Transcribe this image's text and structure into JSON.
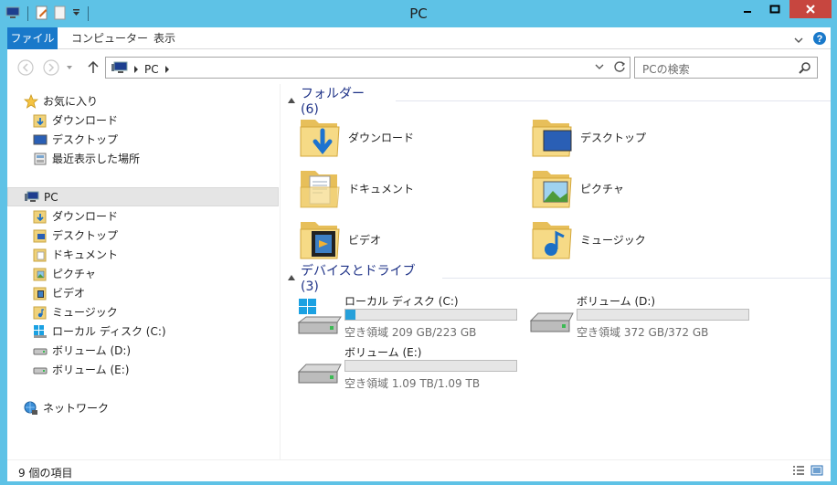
{
  "window": {
    "title": "PC"
  },
  "ribbon": {
    "tabs": [
      {
        "label": "ファイル"
      },
      {
        "label": "コンピューター"
      },
      {
        "label": "表示"
      }
    ]
  },
  "address": {
    "crumb": "PC"
  },
  "search": {
    "placeholder": "PCの検索"
  },
  "nav": {
    "favorites": {
      "label": "お気に入り",
      "items": [
        "ダウンロード",
        "デスクトップ",
        "最近表示した場所"
      ]
    },
    "pc": {
      "label": "PC",
      "items": [
        "ダウンロード",
        "デスクトップ",
        "ドキュメント",
        "ピクチャ",
        "ビデオ",
        "ミュージック",
        "ローカル ディスク (C:)",
        "ボリューム (D:)",
        "ボリューム (E:)"
      ]
    },
    "network": {
      "label": "ネットワーク"
    }
  },
  "content": {
    "folders_group": "フォルダー (6)",
    "folders": [
      "ダウンロード",
      "デスクトップ",
      "ドキュメント",
      "ピクチャ",
      "ビデオ",
      "ミュージック"
    ],
    "drives_group": "デバイスとドライブ (3)",
    "drives": [
      {
        "name": "ローカル ディスク (C:)",
        "free": "空き領域 209 GB/223 GB",
        "used_fraction": 0.06
      },
      {
        "name": "ボリューム (D:)",
        "free": "空き領域 372 GB/372 GB",
        "used_fraction": 0.0
      },
      {
        "name": "ボリューム (E:)",
        "free": "空き領域 1.09 TB/1.09 TB",
        "used_fraction": 0.0
      }
    ]
  },
  "status": {
    "count": "9 個の項目"
  },
  "colors": {
    "frame": "#5ec2e6",
    "accent": "#1979ca",
    "close": "#c7463f",
    "group_text": "#1e3287",
    "bar_fill": "#26a0da"
  }
}
